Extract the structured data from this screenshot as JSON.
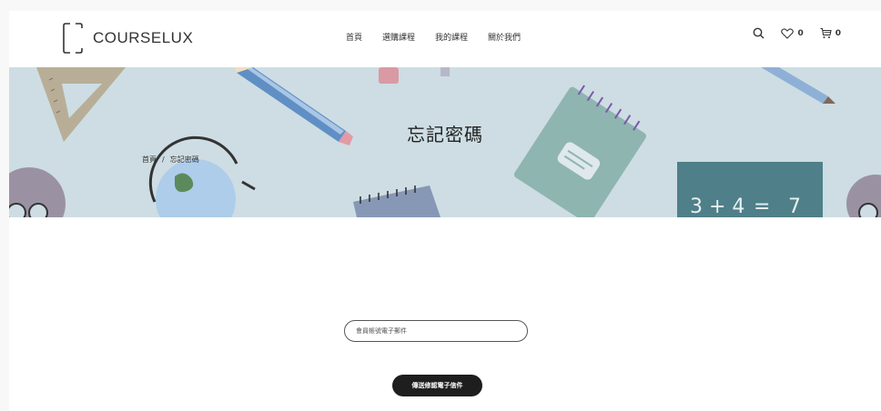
{
  "header": {
    "logo_text": "COURSELUX",
    "nav": [
      {
        "label": "首頁"
      },
      {
        "label": "選購課程"
      },
      {
        "label": "我的課程"
      },
      {
        "label": "關於我們"
      }
    ],
    "wishlist_count": "0",
    "cart_count": "0"
  },
  "hero": {
    "title": "忘記密碼",
    "breadcrumb": {
      "home": "首頁",
      "separator": "/",
      "current": "忘記密碼"
    },
    "equation_left": "3 + 4",
    "equation_eq": "=",
    "equation_right": "7"
  },
  "form": {
    "email_placeholder": "會員帳號電子郵件",
    "submit_label": "傳送修認電子信件"
  },
  "colors": {
    "hero_bg": "#cddde3",
    "button_bg": "#1e1e1e",
    "chalkboard": "#4f7f88",
    "notebook": "#8fb5b0"
  }
}
